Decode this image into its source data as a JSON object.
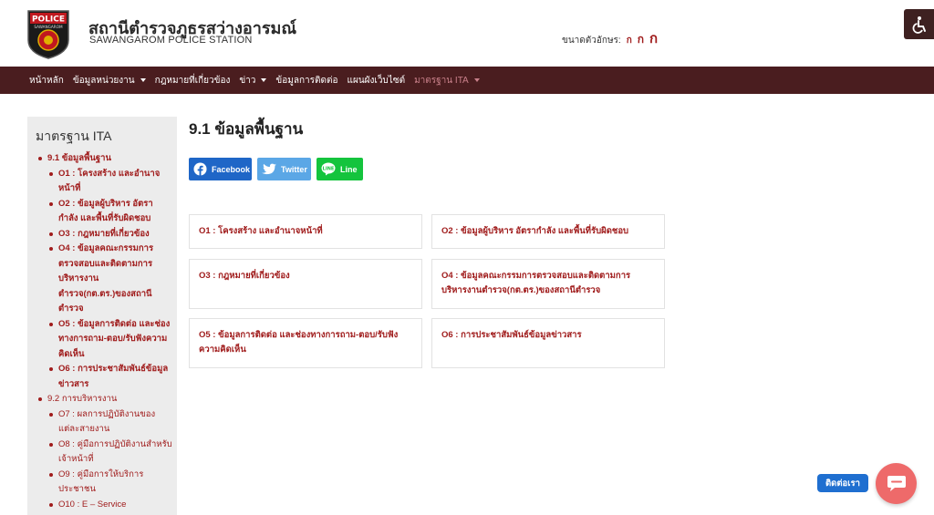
{
  "header": {
    "title": "สถานีตำรวจภูธรสว่างอารมณ์",
    "subtitle": "SAWANGAROM POLICE STATION",
    "logo_text_top": "POLICE",
    "logo_text_bottom": "SAWANGAROM",
    "font_size_label": "ขนาดตัวอักษร:",
    "font_size_options": [
      "ก",
      "ก",
      "ก"
    ]
  },
  "nav": {
    "items": [
      {
        "label": "หน้าหลัก"
      },
      {
        "label": "ข้อมูลหน่วยงาน"
      },
      {
        "label": "กฎหมายที่เกี่ยวข้อง"
      },
      {
        "label": "ข่าว"
      },
      {
        "label": "ข้อมูลการติดต่อ"
      },
      {
        "label": "แผนผังเว็บไซต์"
      },
      {
        "label": "มาตรฐาน ITA"
      }
    ]
  },
  "sidebar": {
    "title": "มาตรฐาน ITA",
    "items": [
      {
        "label": "9.1 ข้อมูลพื้นฐาน"
      },
      {
        "label": "O1 : โครงสร้าง และอำนาจหน้าที่"
      },
      {
        "label": "O2 : ข้อมูลผู้บริหาร อัตรากำลัง และพื้นที่รับผิดชอบ"
      },
      {
        "label": "O3 : กฎหมายที่เกี่ยวข้อง"
      },
      {
        "label": "O4 : ข้อมูลคณะกรรมการตรวจสอบและติดตามการบริหารงาน ตำรวจ(กต.ตร.)ของสถานีตำรวจ"
      },
      {
        "label": "O5 : ข้อมูลการติดต่อ และช่องทางการถาม-ตอบ/รับฟังความคิดเห็น"
      },
      {
        "label": "O6 : การประชาสัมพันธ์ข้อมูลข่าวสาร"
      },
      {
        "label": "9.2 การบริหารงาน"
      },
      {
        "label": "O7 : ผลการปฏิบัติงานของแต่ละสายงาน"
      },
      {
        "label": "O8 : คู่มือการปฏิบัติงานสำหรับเจ้าหน้าที่"
      },
      {
        "label": "O9 : คู่มือการให้บริการประชาชน"
      },
      {
        "label": "O10 : E – Service"
      }
    ]
  },
  "main": {
    "heading": "9.1 ข้อมูลพื้นฐาน",
    "share": {
      "facebook": "Facebook",
      "twitter": "Twitter",
      "line": "Line"
    },
    "cards": [
      {
        "label": "O1 : โครงสร้าง และอำนาจหน้าที่"
      },
      {
        "label": "O2 : ข้อมูลผู้บริหาร อัตรากำลัง และพื้นที่รับผิดชอบ"
      },
      {
        "label": "O3 : กฎหมายที่เกี่ยวข้อง"
      },
      {
        "label": "O4 : ข้อมูลคณะกรรมการตรวจสอบและติดตามการบริหารงานตำรวจ(กต.ตร.)ของสถานีตำรวจ"
      },
      {
        "label": "O5 : ข้อมูลการติดต่อ และช่องทางการถาม-ตอบ/รับฟังความคิดเห็น"
      },
      {
        "label": "O6 : การประชาสัมพันธ์ข้อมูลข่าวสาร"
      }
    ]
  },
  "chat": {
    "label": "ติดต่อเรา"
  },
  "colors": {
    "nav_bg": "#4a1d1f",
    "accent_red": "#a01c1c",
    "facebook": "#1f66c7",
    "twitter": "#5ba7e6",
    "line": "#14c43d",
    "chat": "#ee6a6a"
  },
  "icons": [
    "police-logo-icon",
    "accessibility-icon",
    "facebook-icon",
    "twitter-icon",
    "line-icon",
    "chat-icon"
  ]
}
